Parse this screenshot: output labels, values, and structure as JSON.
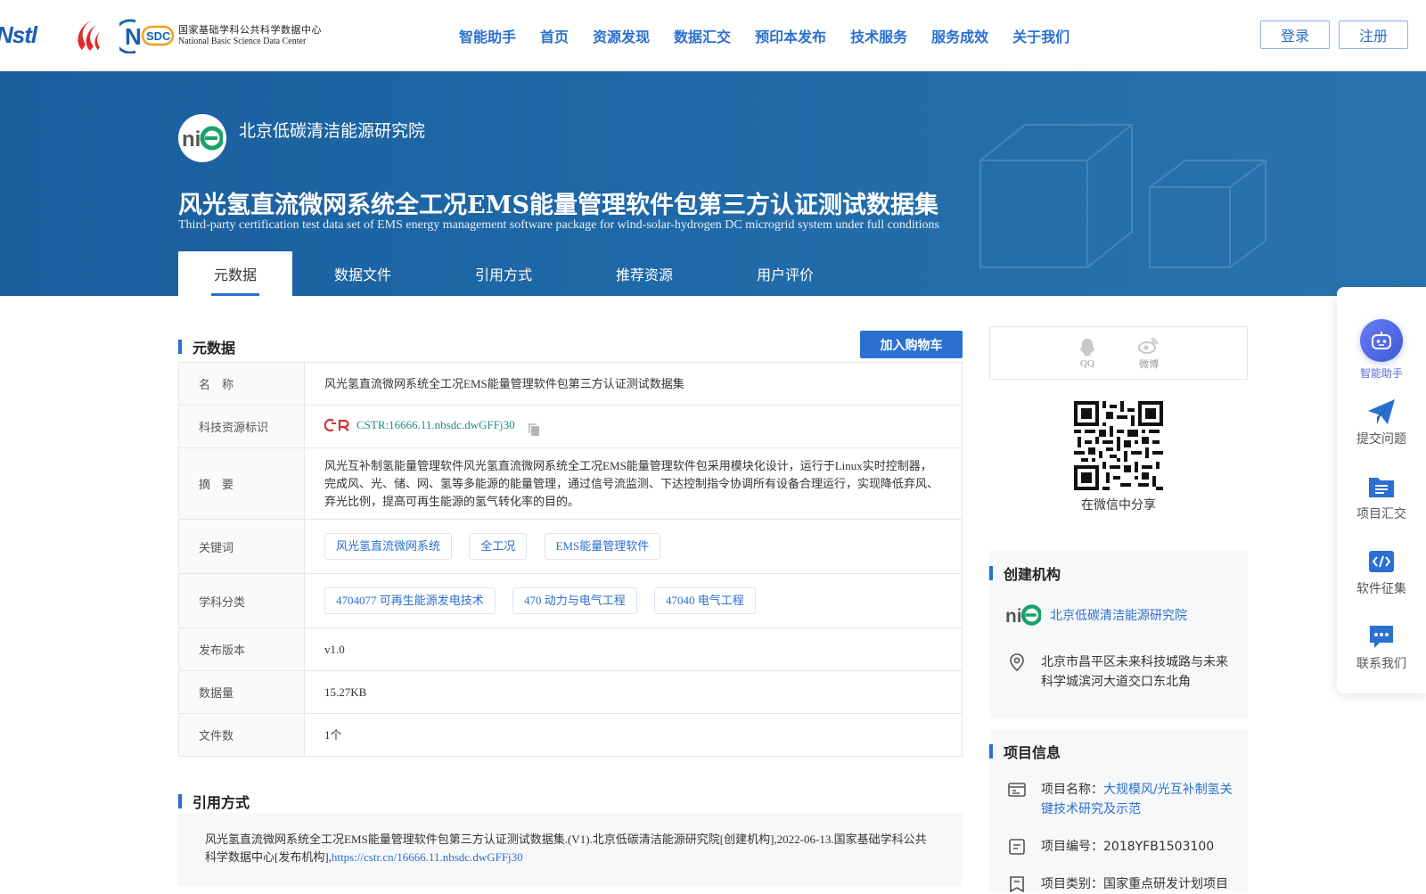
{
  "header": {
    "logo_nstl": "Nstl",
    "nsdc_cn": "国家基础学科公共科学数据中心",
    "nsdc_en": "National Basic Science Data Center",
    "nav": [
      "智能助手",
      "首页",
      "资源发现",
      "数据汇交",
      "预印本发布",
      "技术服务",
      "服务成效",
      "关于我们"
    ],
    "login": "登录",
    "register": "注册"
  },
  "banner": {
    "org_name": "北京低碳清洁能源研究院",
    "title": "风光氢直流微网系统全工况EMS能量管理软件包第三方认证测试数据集",
    "title_en": "Third-party certification test data set of EMS energy management software package for wind-solar-hydrogen DC microgrid system under full conditions",
    "tabs": [
      "元数据",
      "数据文件",
      "引用方式",
      "推荐资源",
      "用户评价"
    ]
  },
  "metadata": {
    "section_title": "元数据",
    "cart_button": "加入购物车",
    "rows": {
      "name_label": "名　称",
      "name_value": "风光氢直流微网系统全工况EMS能量管理软件包第三方认证测试数据集",
      "cstr_label": "科技资源标识",
      "cstr_value": "CSTR:16666.11.nbsdc.dwGFFj30",
      "abstract_label": "摘　要",
      "abstract_value": "风光互补制氢能量管理软件风光氢直流微网系统全工况EMS能量管理软件包采用模块化设计，运行于Linux实时控制器，完成风、光、储、网、氢等多能源的能量管理，通过信号流监测、下达控制指令协调所有设备合理运行，实现降低弃风、弃光比例，提高可再生能源的氢气转化率的目的。",
      "keywords_label": "关键词",
      "keywords": [
        "风光氢直流微网系统",
        "全工况",
        "EMS能量管理软件"
      ],
      "subject_label": "学科分类",
      "subjects": [
        "4704077 可再生能源发电技术",
        "470 动力与电气工程",
        "47040 电气工程"
      ],
      "version_label": "发布版本",
      "version_value": "v1.0",
      "size_label": "数据量",
      "size_value": "15.27KB",
      "files_label": "文件数",
      "files_value": "1个"
    }
  },
  "citation": {
    "section_title": "引用方式",
    "text": "风光氢直流微网系统全工况EMS能量管理软件包第三方认证测试数据集.(V1).北京低碳清洁能源研究院[创建机构],2022-06-13.国家基础学科公共科学数据中心[发布机构],",
    "link": "https://cstr.cn/16666.11.nbsdc.dwGFFj30"
  },
  "share": {
    "qq": "QQ",
    "weibo": "微博",
    "wechat_label": "在微信中分享"
  },
  "creator": {
    "section_title": "创建机构",
    "org_name": "北京低碳清洁能源研究院",
    "address": "北京市昌平区未来科技城路与未来科学城滨河大道交口东北角"
  },
  "project": {
    "section_title": "项目信息",
    "name_label": "项目名称：",
    "name_value": "大规模风/光互补制氢关键技术研究及示范",
    "code_label": "项目编号：",
    "code_value": "2018YFB1503100",
    "type_label": "项目类别：",
    "type_value": "国家重点研发计划项目"
  },
  "float_bar": {
    "ai": "智能助手",
    "submit_issue": "提交问题",
    "project_submit": "项目汇交",
    "software_call": "软件征集",
    "contact": "联系我们"
  },
  "colors": {
    "primary": "#2a6fd1",
    "banner": "#1f6aa8",
    "teal": "#1c8a8a"
  }
}
